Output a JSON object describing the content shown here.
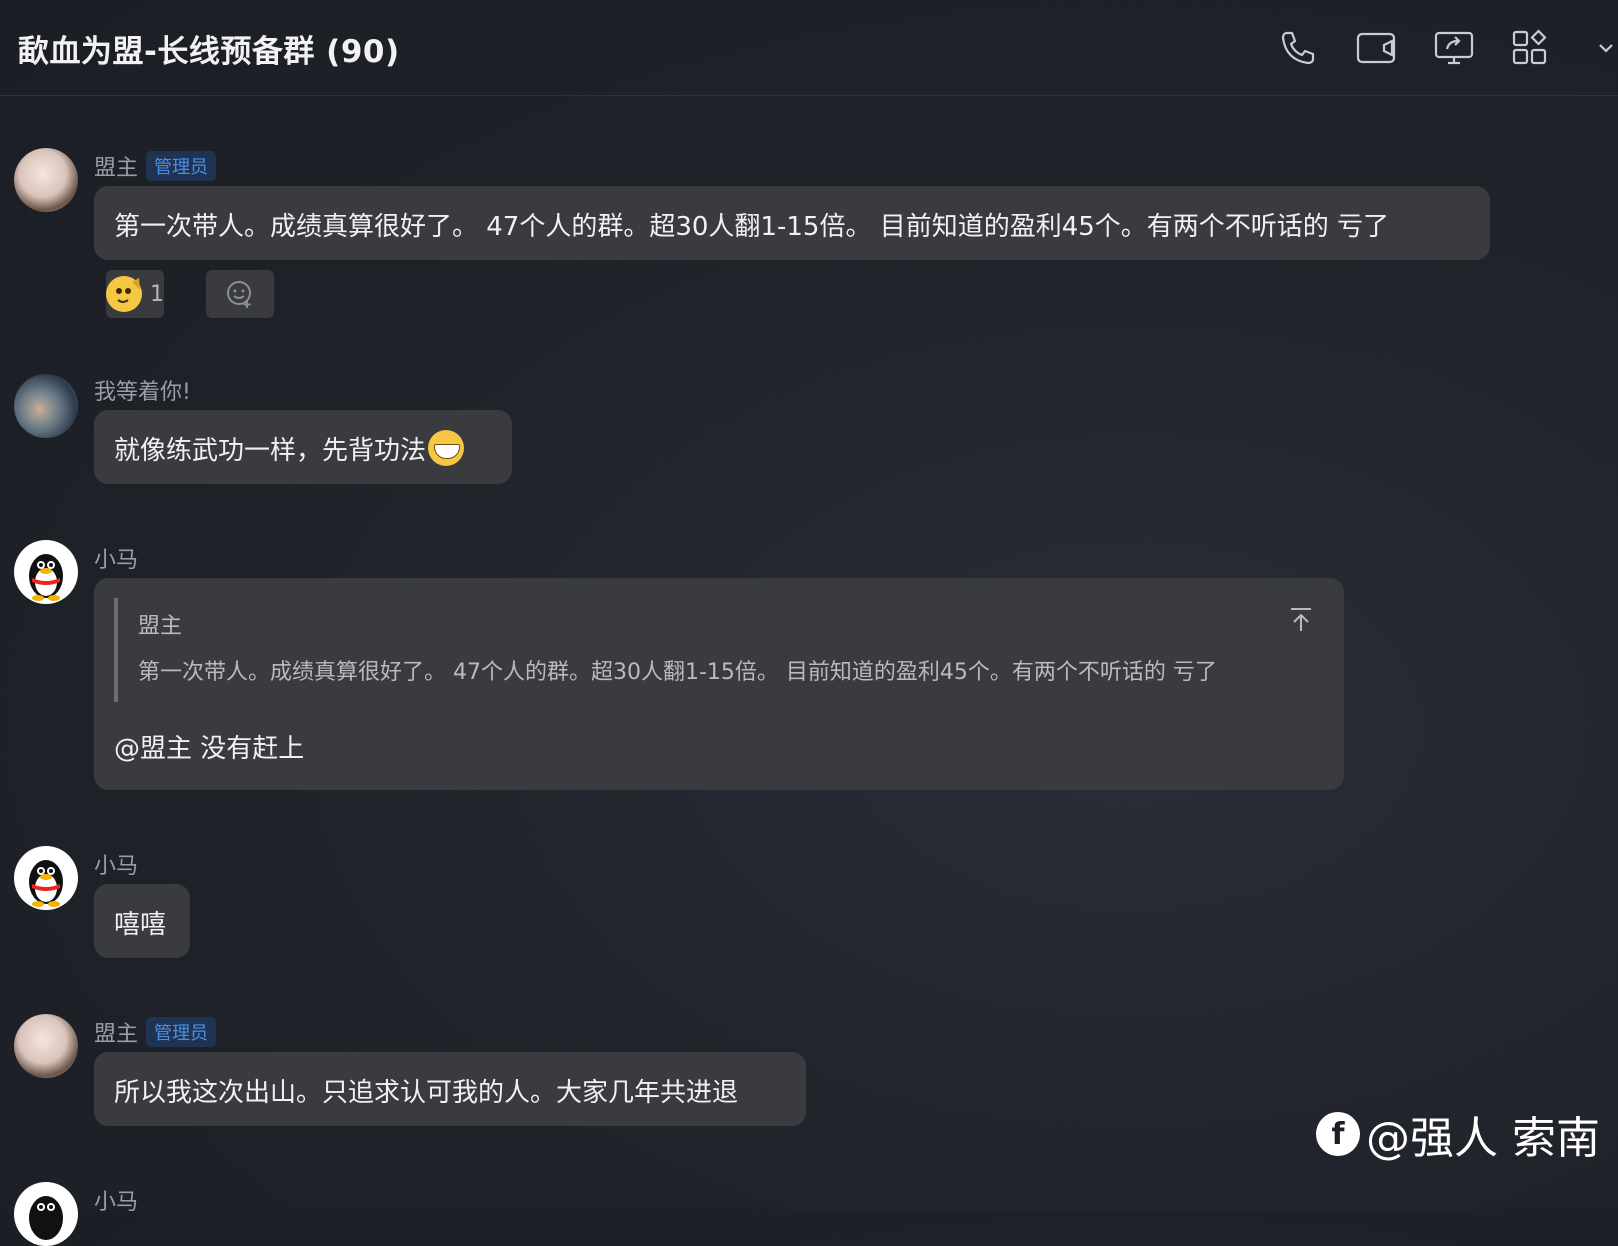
{
  "header": {
    "title": "歃血为盟-长线预备群 (90)",
    "icons": [
      "phone-icon",
      "video-camera-icon",
      "screen-share-icon",
      "apps-grid-icon"
    ]
  },
  "messages": [
    {
      "sender": "盟主",
      "badge": "管理员",
      "avatar": "anime-girl-avatar",
      "text": "第一次带人。成绩真算很好了。 47个人的群。超30人翻1-15倍。 目前知道的盈利45个。有两个不听话的 亏了",
      "reaction": {
        "emoji": "salute-face-emoji",
        "count": "1"
      }
    },
    {
      "sender": "我等着你!",
      "avatar": "photo-avatar",
      "text": "就像练武功一样，先背功法"
    },
    {
      "sender": "小马",
      "avatar": "qq-penguin-avatar",
      "quote": {
        "sender": "盟主",
        "text": "第一次带人。成绩真算很好了。 47个人的群。超30人翻1-15倍。 目前知道的盈利45个。有两个不听话的 亏了"
      },
      "text": "@盟主 没有赶上"
    },
    {
      "sender": "小马",
      "avatar": "qq-penguin-avatar",
      "text": "嘻嘻"
    },
    {
      "sender": "盟主",
      "badge": "管理员",
      "avatar": "anime-girl-avatar",
      "text": "所以我这次出山。只追求认可我的人。大家几年共进退"
    },
    {
      "sender": "小马",
      "avatar": "qq-penguin-avatar"
    }
  ],
  "watermark": {
    "text": "@强人 索南"
  }
}
